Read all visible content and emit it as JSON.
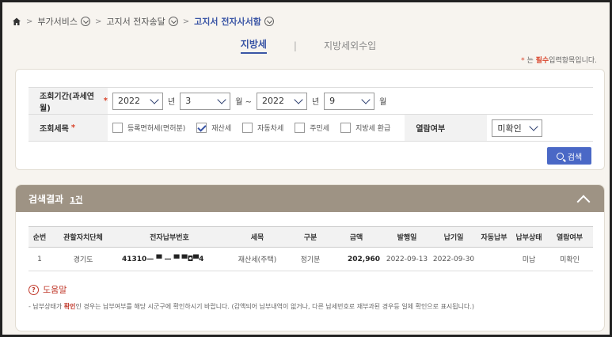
{
  "breadcrumb": {
    "items": [
      "부가서비스",
      "고지서 전자송달",
      "고지서 전자사서함"
    ]
  },
  "tabs": {
    "active": "지방세",
    "separator": "|",
    "inactive": "지방세외수입"
  },
  "required_note": {
    "star": "*",
    "prefix": "는",
    "word": "필수",
    "suffix": "입력항목입니다."
  },
  "form": {
    "period_label": "조회기간(과세연월)",
    "period": {
      "from_year": "2022",
      "year_unit": "년",
      "from_month": "3",
      "month_unit_range": "월 ~",
      "to_year": "2022",
      "to_month": "9",
      "month_unit": "월"
    },
    "tax_item_label": "조회세목",
    "tax_items": [
      {
        "label": "등록면허세(면허분)",
        "checked": false
      },
      {
        "label": "재산세",
        "checked": true
      },
      {
        "label": "자동차세",
        "checked": false
      },
      {
        "label": "주민세",
        "checked": false
      },
      {
        "label": "지방세 환급",
        "checked": false
      }
    ],
    "view_status_label": "열람여부",
    "view_status_value": "미확인",
    "search_button": "검색"
  },
  "result": {
    "title": "검색결과",
    "count": "1건",
    "columns": [
      "순번",
      "관할자치단체",
      "전자납부번호",
      "세목",
      "구분",
      "금액",
      "발행일",
      "납기일",
      "자동납부",
      "납부상태",
      "열람여부"
    ],
    "rows": [
      {
        "seq": "1",
        "region": "경기도",
        "payment_no": "41310— ▀ — ▀ ▀◘▀4",
        "tax": "재산세(주택)",
        "type": "정기분",
        "amount": "202,960",
        "issue_date": "2022-09-13",
        "due_date": "2022-09-30",
        "auto_pay": "",
        "pay_status": "미납",
        "view_status": "미확인"
      }
    ],
    "help_label": "도움말",
    "note_prefix": "- 납부상태가",
    "note_highlight": "확인",
    "note_suffix": "인 경우는 납부여부를 해당 시군구에 확인하시기 바랍니다. (감액되어 납부내역이 없거나, 다른 납세번호로 재부과된 경우등 일체 확인으로 표시됩니다.)"
  },
  "colors": {
    "accent": "#3a55a5",
    "button": "#4a68c6",
    "result_header": "#9e9384",
    "required": "#d9442b"
  }
}
